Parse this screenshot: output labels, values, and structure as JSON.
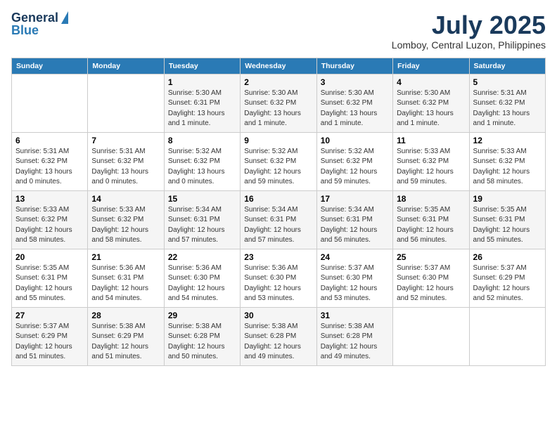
{
  "logo": {
    "line1": "General",
    "line2": "Blue"
  },
  "title": "July 2025",
  "location": "Lomboy, Central Luzon, Philippines",
  "days_of_week": [
    "Sunday",
    "Monday",
    "Tuesday",
    "Wednesday",
    "Thursday",
    "Friday",
    "Saturday"
  ],
  "weeks": [
    [
      {
        "day": "",
        "sunrise": "",
        "sunset": "",
        "daylight": ""
      },
      {
        "day": "",
        "sunrise": "",
        "sunset": "",
        "daylight": ""
      },
      {
        "day": "1",
        "sunrise": "Sunrise: 5:30 AM",
        "sunset": "Sunset: 6:31 PM",
        "daylight": "Daylight: 13 hours and 1 minute."
      },
      {
        "day": "2",
        "sunrise": "Sunrise: 5:30 AM",
        "sunset": "Sunset: 6:32 PM",
        "daylight": "Daylight: 13 hours and 1 minute."
      },
      {
        "day": "3",
        "sunrise": "Sunrise: 5:30 AM",
        "sunset": "Sunset: 6:32 PM",
        "daylight": "Daylight: 13 hours and 1 minute."
      },
      {
        "day": "4",
        "sunrise": "Sunrise: 5:30 AM",
        "sunset": "Sunset: 6:32 PM",
        "daylight": "Daylight: 13 hours and 1 minute."
      },
      {
        "day": "5",
        "sunrise": "Sunrise: 5:31 AM",
        "sunset": "Sunset: 6:32 PM",
        "daylight": "Daylight: 13 hours and 1 minute."
      }
    ],
    [
      {
        "day": "6",
        "sunrise": "Sunrise: 5:31 AM",
        "sunset": "Sunset: 6:32 PM",
        "daylight": "Daylight: 13 hours and 0 minutes."
      },
      {
        "day": "7",
        "sunrise": "Sunrise: 5:31 AM",
        "sunset": "Sunset: 6:32 PM",
        "daylight": "Daylight: 13 hours and 0 minutes."
      },
      {
        "day": "8",
        "sunrise": "Sunrise: 5:32 AM",
        "sunset": "Sunset: 6:32 PM",
        "daylight": "Daylight: 13 hours and 0 minutes."
      },
      {
        "day": "9",
        "sunrise": "Sunrise: 5:32 AM",
        "sunset": "Sunset: 6:32 PM",
        "daylight": "Daylight: 12 hours and 59 minutes."
      },
      {
        "day": "10",
        "sunrise": "Sunrise: 5:32 AM",
        "sunset": "Sunset: 6:32 PM",
        "daylight": "Daylight: 12 hours and 59 minutes."
      },
      {
        "day": "11",
        "sunrise": "Sunrise: 5:33 AM",
        "sunset": "Sunset: 6:32 PM",
        "daylight": "Daylight: 12 hours and 59 minutes."
      },
      {
        "day": "12",
        "sunrise": "Sunrise: 5:33 AM",
        "sunset": "Sunset: 6:32 PM",
        "daylight": "Daylight: 12 hours and 58 minutes."
      }
    ],
    [
      {
        "day": "13",
        "sunrise": "Sunrise: 5:33 AM",
        "sunset": "Sunset: 6:32 PM",
        "daylight": "Daylight: 12 hours and 58 minutes."
      },
      {
        "day": "14",
        "sunrise": "Sunrise: 5:33 AM",
        "sunset": "Sunset: 6:32 PM",
        "daylight": "Daylight: 12 hours and 58 minutes."
      },
      {
        "day": "15",
        "sunrise": "Sunrise: 5:34 AM",
        "sunset": "Sunset: 6:31 PM",
        "daylight": "Daylight: 12 hours and 57 minutes."
      },
      {
        "day": "16",
        "sunrise": "Sunrise: 5:34 AM",
        "sunset": "Sunset: 6:31 PM",
        "daylight": "Daylight: 12 hours and 57 minutes."
      },
      {
        "day": "17",
        "sunrise": "Sunrise: 5:34 AM",
        "sunset": "Sunset: 6:31 PM",
        "daylight": "Daylight: 12 hours and 56 minutes."
      },
      {
        "day": "18",
        "sunrise": "Sunrise: 5:35 AM",
        "sunset": "Sunset: 6:31 PM",
        "daylight": "Daylight: 12 hours and 56 minutes."
      },
      {
        "day": "19",
        "sunrise": "Sunrise: 5:35 AM",
        "sunset": "Sunset: 6:31 PM",
        "daylight": "Daylight: 12 hours and 55 minutes."
      }
    ],
    [
      {
        "day": "20",
        "sunrise": "Sunrise: 5:35 AM",
        "sunset": "Sunset: 6:31 PM",
        "daylight": "Daylight: 12 hours and 55 minutes."
      },
      {
        "day": "21",
        "sunrise": "Sunrise: 5:36 AM",
        "sunset": "Sunset: 6:31 PM",
        "daylight": "Daylight: 12 hours and 54 minutes."
      },
      {
        "day": "22",
        "sunrise": "Sunrise: 5:36 AM",
        "sunset": "Sunset: 6:30 PM",
        "daylight": "Daylight: 12 hours and 54 minutes."
      },
      {
        "day": "23",
        "sunrise": "Sunrise: 5:36 AM",
        "sunset": "Sunset: 6:30 PM",
        "daylight": "Daylight: 12 hours and 53 minutes."
      },
      {
        "day": "24",
        "sunrise": "Sunrise: 5:37 AM",
        "sunset": "Sunset: 6:30 PM",
        "daylight": "Daylight: 12 hours and 53 minutes."
      },
      {
        "day": "25",
        "sunrise": "Sunrise: 5:37 AM",
        "sunset": "Sunset: 6:30 PM",
        "daylight": "Daylight: 12 hours and 52 minutes."
      },
      {
        "day": "26",
        "sunrise": "Sunrise: 5:37 AM",
        "sunset": "Sunset: 6:29 PM",
        "daylight": "Daylight: 12 hours and 52 minutes."
      }
    ],
    [
      {
        "day": "27",
        "sunrise": "Sunrise: 5:37 AM",
        "sunset": "Sunset: 6:29 PM",
        "daylight": "Daylight: 12 hours and 51 minutes."
      },
      {
        "day": "28",
        "sunrise": "Sunrise: 5:38 AM",
        "sunset": "Sunset: 6:29 PM",
        "daylight": "Daylight: 12 hours and 51 minutes."
      },
      {
        "day": "29",
        "sunrise": "Sunrise: 5:38 AM",
        "sunset": "Sunset: 6:28 PM",
        "daylight": "Daylight: 12 hours and 50 minutes."
      },
      {
        "day": "30",
        "sunrise": "Sunrise: 5:38 AM",
        "sunset": "Sunset: 6:28 PM",
        "daylight": "Daylight: 12 hours and 49 minutes."
      },
      {
        "day": "31",
        "sunrise": "Sunrise: 5:38 AM",
        "sunset": "Sunset: 6:28 PM",
        "daylight": "Daylight: 12 hours and 49 minutes."
      },
      {
        "day": "",
        "sunrise": "",
        "sunset": "",
        "daylight": ""
      },
      {
        "day": "",
        "sunrise": "",
        "sunset": "",
        "daylight": ""
      }
    ]
  ]
}
